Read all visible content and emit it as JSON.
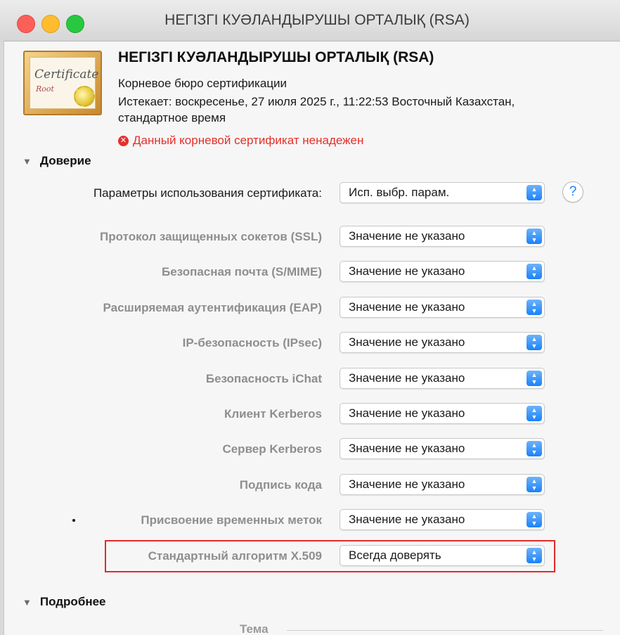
{
  "window": {
    "title": "НЕГІЗГІ КУӘЛАНДЫРУШЫ ОРТАЛЫҚ (RSA)"
  },
  "certificate": {
    "icon_word": "Certificate",
    "icon_sub": "Root",
    "name": "НЕГІЗГІ КУӘЛАНДЫРУШЫ ОРТАЛЫҚ (RSA)",
    "type": "Корневое бюро сертификации",
    "expires_line1": "Истекает: воскресенье, 27 июля 2025 г., 11:22:53 Восточный Казахстан,",
    "expires_line2": "стандартное время",
    "warning": "Данный корневой сертификат ненадежен",
    "warning_color": "#e4302a"
  },
  "trust": {
    "section_label": "Доверие",
    "usage_label": "Параметры использования сертификата:",
    "usage_value": "Исп. выбр. парам.",
    "help_label": "?",
    "rows": [
      {
        "label": "Протокол защищенных сокетов (SSL)",
        "value": "Значение не указано"
      },
      {
        "label": "Безопасная почта (S/MIME)",
        "value": "Значение не указано"
      },
      {
        "label": "Расширяемая аутентификация (EAP)",
        "value": "Значение не указано"
      },
      {
        "label": "IP-безопасность (IPsec)",
        "value": "Значение не указано"
      },
      {
        "label": "Безопасность iChat",
        "value": "Значение не указано"
      },
      {
        "label": "Клиент Kerberos",
        "value": "Значение не указано"
      },
      {
        "label": "Сервер Kerberos",
        "value": "Значение не указано"
      },
      {
        "label": "Подпись кода",
        "value": "Значение не указано"
      },
      {
        "label": "Присвоение временных меток",
        "value": "Значение не указано"
      },
      {
        "label": "Стандартный алгоритм X.509",
        "value": "Всегда доверять"
      }
    ]
  },
  "details": {
    "section_label": "Подробнее",
    "subject_label": "Тема"
  },
  "colors": {
    "accent": "#1a82fb",
    "highlight_border": "#e32a2a"
  }
}
